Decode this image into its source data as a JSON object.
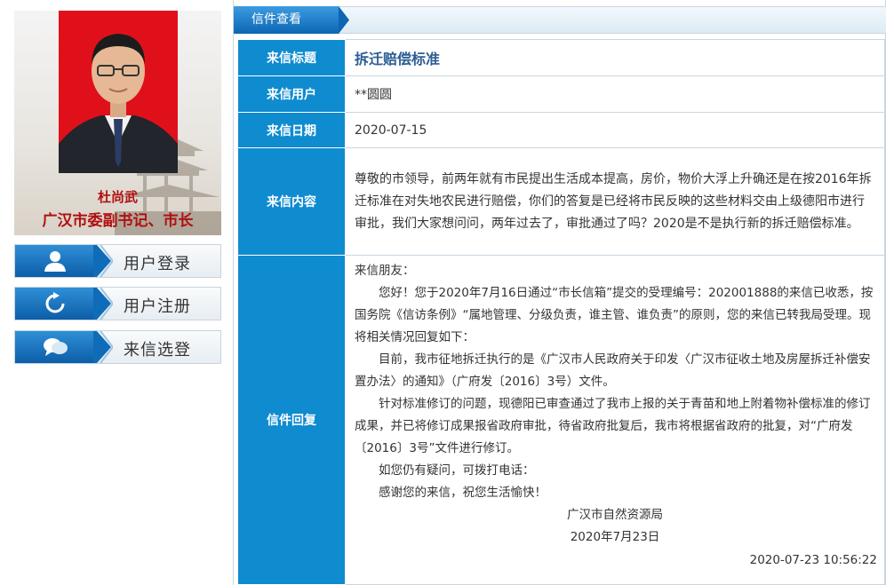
{
  "profile": {
    "name": "杜尚武",
    "title": "广汉市委副书记、市长"
  },
  "nav": [
    {
      "label": "用户登录",
      "icon": "user-icon"
    },
    {
      "label": "用户注册",
      "icon": "refresh-icon"
    },
    {
      "label": "来信选登",
      "icon": "chat-bubbles-icon"
    }
  ],
  "panel": {
    "heading": "信件查看"
  },
  "letter": {
    "title_key": "来信标题",
    "title": "拆迁赔偿标准",
    "user_key": "来信用户",
    "user": "**圆圆",
    "date_key": "来信日期",
    "date": "2020-07-15",
    "content_key": "来信内容",
    "content": "尊敬的市领导，前两年就有市民提出生活成本提高，房价，物价大浮上升确还是在按2016年拆迁标准在对失地农民进行赔偿，你们的答复是已经将市民反映的这些材料交由上级德阳市进行审批，我们大家想问问，两年过去了，审批通过了吗？2020是不是执行新的拆迁赔偿标准。",
    "reply_key": "信件回复",
    "reply": {
      "greeting": "来信朋友：",
      "p1": "您好！您于2020年7月16日通过“市长信箱”提交的受理编号：202001888的来信已收悉，按国务院《信访条例》“属地管理、分级负责，谁主管、谁负责”的原则，您的来信已转我局受理。现将相关情况回复如下：",
      "p2": "目前，我市征地拆迁执行的是《广汉市人民政府关于印发〈广汉市征收土地及房屋拆迁补偿安置办法〉的通知》（广府发〔2016〕3号）文件。",
      "p3": "针对标准修订的问题，现德阳已审查通过了我市上报的关于青苗和地上附着物补偿标准的修订成果，并已将修订成果报省政府审批，待省政府批复后，我市将根据省政府的批复，对“广府发〔2016〕3号”文件进行修订。",
      "p4": "如您仍有疑问，可拨打电话：",
      "p5": "感谢您的来信，祝您生活愉快！",
      "org": "广汉市自然资源局",
      "sign_date": "2020年7月23日",
      "timestamp": "2020-07-23 10:56:22"
    }
  },
  "colors": {
    "accent_blue": "#0f8bd0",
    "profile_red": "#b01010",
    "photo_bg": "#e0101a",
    "title_blue": "#2c5d93"
  }
}
